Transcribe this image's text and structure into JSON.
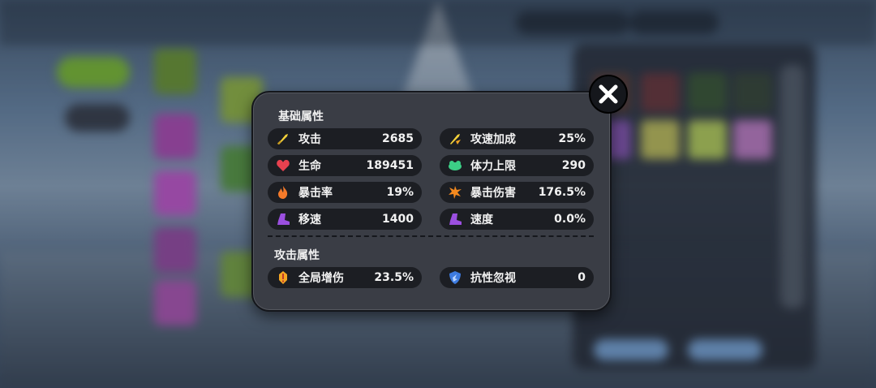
{
  "popup": {
    "basic_title": "基础属性",
    "attack_title": "攻击属性",
    "basic_stats": [
      {
        "label": "攻击",
        "value": "2685",
        "icon": "sword-icon"
      },
      {
        "label": "攻速加成",
        "value": "25%",
        "icon": "attack-speed-icon"
      },
      {
        "label": "生命",
        "value": "189451",
        "icon": "heart-icon"
      },
      {
        "label": "体力上限",
        "value": "290",
        "icon": "stamina-icon"
      },
      {
        "label": "暴击率",
        "value": "19%",
        "icon": "flame-icon"
      },
      {
        "label": "暴击伤害",
        "value": "176.5%",
        "icon": "burst-icon"
      },
      {
        "label": "移速",
        "value": "1400",
        "icon": "boot-icon"
      },
      {
        "label": "速度",
        "value": "0.0%",
        "icon": "boot-icon"
      }
    ],
    "attack_stats": [
      {
        "label": "全局增伤",
        "value": "23.5%",
        "icon": "damage-boost-icon"
      },
      {
        "label": "抗性忽视",
        "value": "0",
        "icon": "shield-icon"
      }
    ]
  },
  "colors": {
    "popup_bg": "#3a3d45",
    "stat_bg": "#1c1e23",
    "text": "#f2f2f2"
  }
}
